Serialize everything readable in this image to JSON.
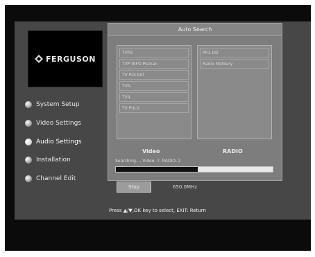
{
  "brand": {
    "logo_text": "FERGUSON"
  },
  "menu": [
    {
      "label": "System Setup",
      "active": false
    },
    {
      "label": "Video Settings",
      "active": false
    },
    {
      "label": "Audio Settings",
      "active": true
    },
    {
      "label": "Installation",
      "active": false
    },
    {
      "label": "Channel Edit",
      "active": false
    }
  ],
  "panel": {
    "title": "Auto Search",
    "video_label": "Video",
    "radio_label": "RADIO",
    "video_channels": [
      "TVP2",
      "TVP INFO Poznan",
      "TV POLSAT",
      "TVN",
      "TV4",
      "TV PULS"
    ],
    "radio_channels": [
      "PR3 DD",
      "Radio Merkury"
    ],
    "status": "Searching.... Video: 7, RADIO: 2",
    "progress": 0.52,
    "stop_label": "Stop",
    "frequency": "650.0MHz"
  },
  "footer": {
    "help": "Press ▲/▼,OK key to select, EXIT: Return"
  },
  "colors": {
    "background": "#474747",
    "panel": "#7d7d7d",
    "accent": "#e8e8e8",
    "text": "#efefef"
  }
}
